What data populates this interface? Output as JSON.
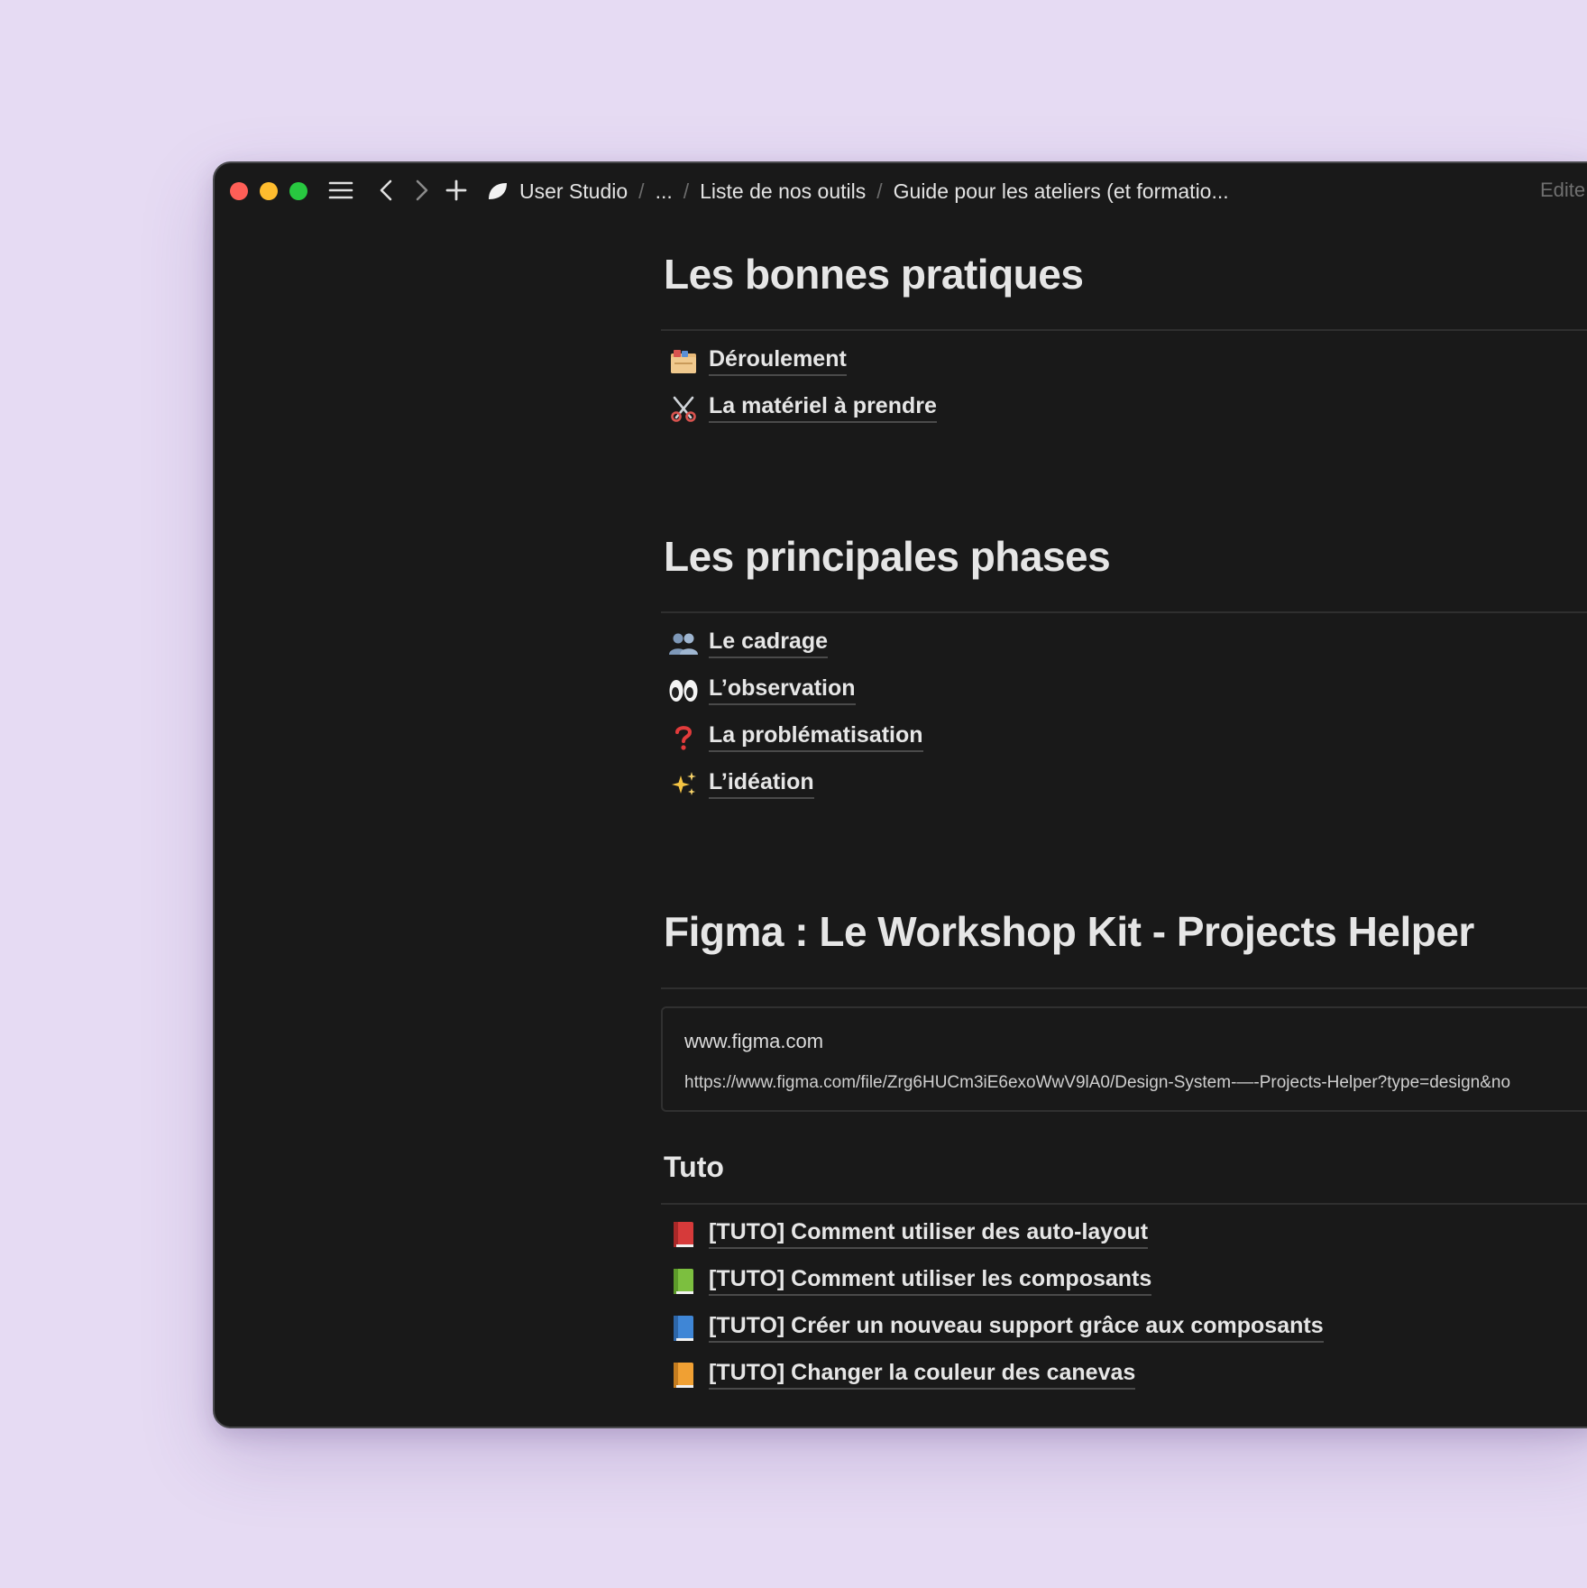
{
  "window": {
    "breadcrumbs": [
      {
        "label": "User Studio"
      },
      {
        "label": "..."
      },
      {
        "label": "Liste de nos outils"
      },
      {
        "label": "Guide pour les ateliers (et formatio..."
      }
    ],
    "edited_label": "Edite"
  },
  "sections": {
    "bonnes_pratiques": {
      "title": "Les bonnes pratiques",
      "links": [
        {
          "icon": "card-index-dividers-icon",
          "label": "Déroulement"
        },
        {
          "icon": "scissors-icon",
          "label": "La matériel à prendre"
        }
      ]
    },
    "principales_phases": {
      "title": "Les principales phases",
      "links": [
        {
          "icon": "two-people-icon",
          "label": "Le cadrage"
        },
        {
          "icon": "eyes-icon",
          "label": "L’observation"
        },
        {
          "icon": "red-question-mark-icon",
          "label": "La problématisation"
        },
        {
          "icon": "sparkles-icon",
          "label": "L’idéation"
        }
      ]
    },
    "figma": {
      "title": "Figma : Le Workshop Kit - Projects Helper",
      "bookmark": {
        "title": "www.figma.com",
        "url": "https://www.figma.com/file/Zrg6HUCm3iE6exoWwV9lA0/Design-System-—-Projects-Helper?type=design&no"
      }
    },
    "tuto": {
      "title": "Tuto",
      "links": [
        {
          "icon": "red-book-icon",
          "label": "[TUTO] Comment utiliser des auto-layout"
        },
        {
          "icon": "green-book-icon",
          "label": "[TUTO] Comment utiliser les composants"
        },
        {
          "icon": "blue-book-icon",
          "label": "[TUTO] Créer un nouveau support grâce aux composants"
        },
        {
          "icon": "orange-book-icon",
          "label": "[TUTO] Changer la couleur des canevas"
        }
      ]
    }
  },
  "colors": {
    "background": "#e6dbf3",
    "window": "#191919",
    "text": "#e6e6e6",
    "muted": "#6f6f6f"
  }
}
